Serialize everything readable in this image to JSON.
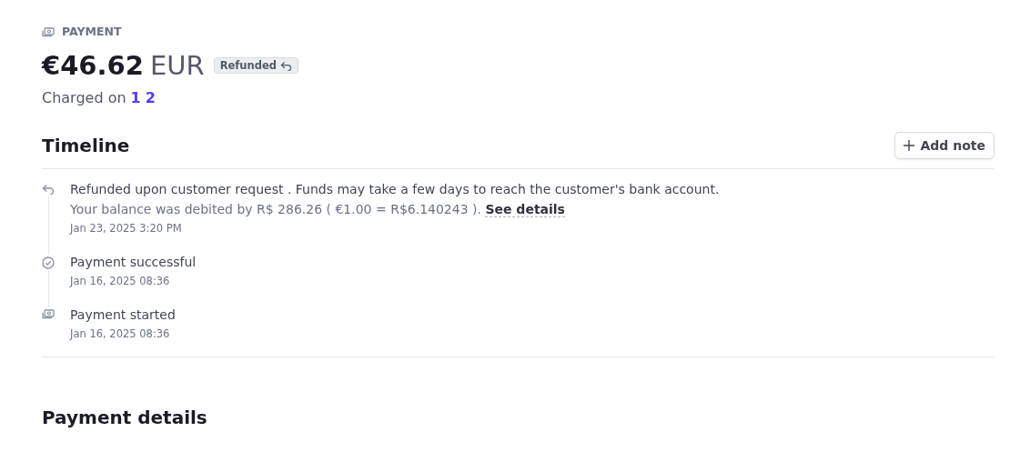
{
  "header": {
    "label": "PAYMENT",
    "amount": "€46.62",
    "currency": "EUR",
    "badge": "Refunded",
    "charged_label": "Charged on",
    "charged_links": [
      "1",
      "2"
    ]
  },
  "timeline": {
    "title": "Timeline",
    "add_button": "Add note",
    "events": [
      {
        "kind": "refund",
        "title": "Refunded upon customer request . Funds may take a few days to reach the customer's bank account.",
        "detail": "Your balance was debited by R$ 286.26 ( €1.00 = R$6.140243 ).",
        "link": "See details",
        "time": "Jan 23, 2025 3:20 PM"
      },
      {
        "kind": "success",
        "title": "Payment successful",
        "time": "Jan 16, 2025 08:36"
      },
      {
        "kind": "started",
        "title": "Payment started",
        "time": "Jan 16, 2025 08:36"
      }
    ]
  },
  "details": {
    "title": "Payment details"
  }
}
